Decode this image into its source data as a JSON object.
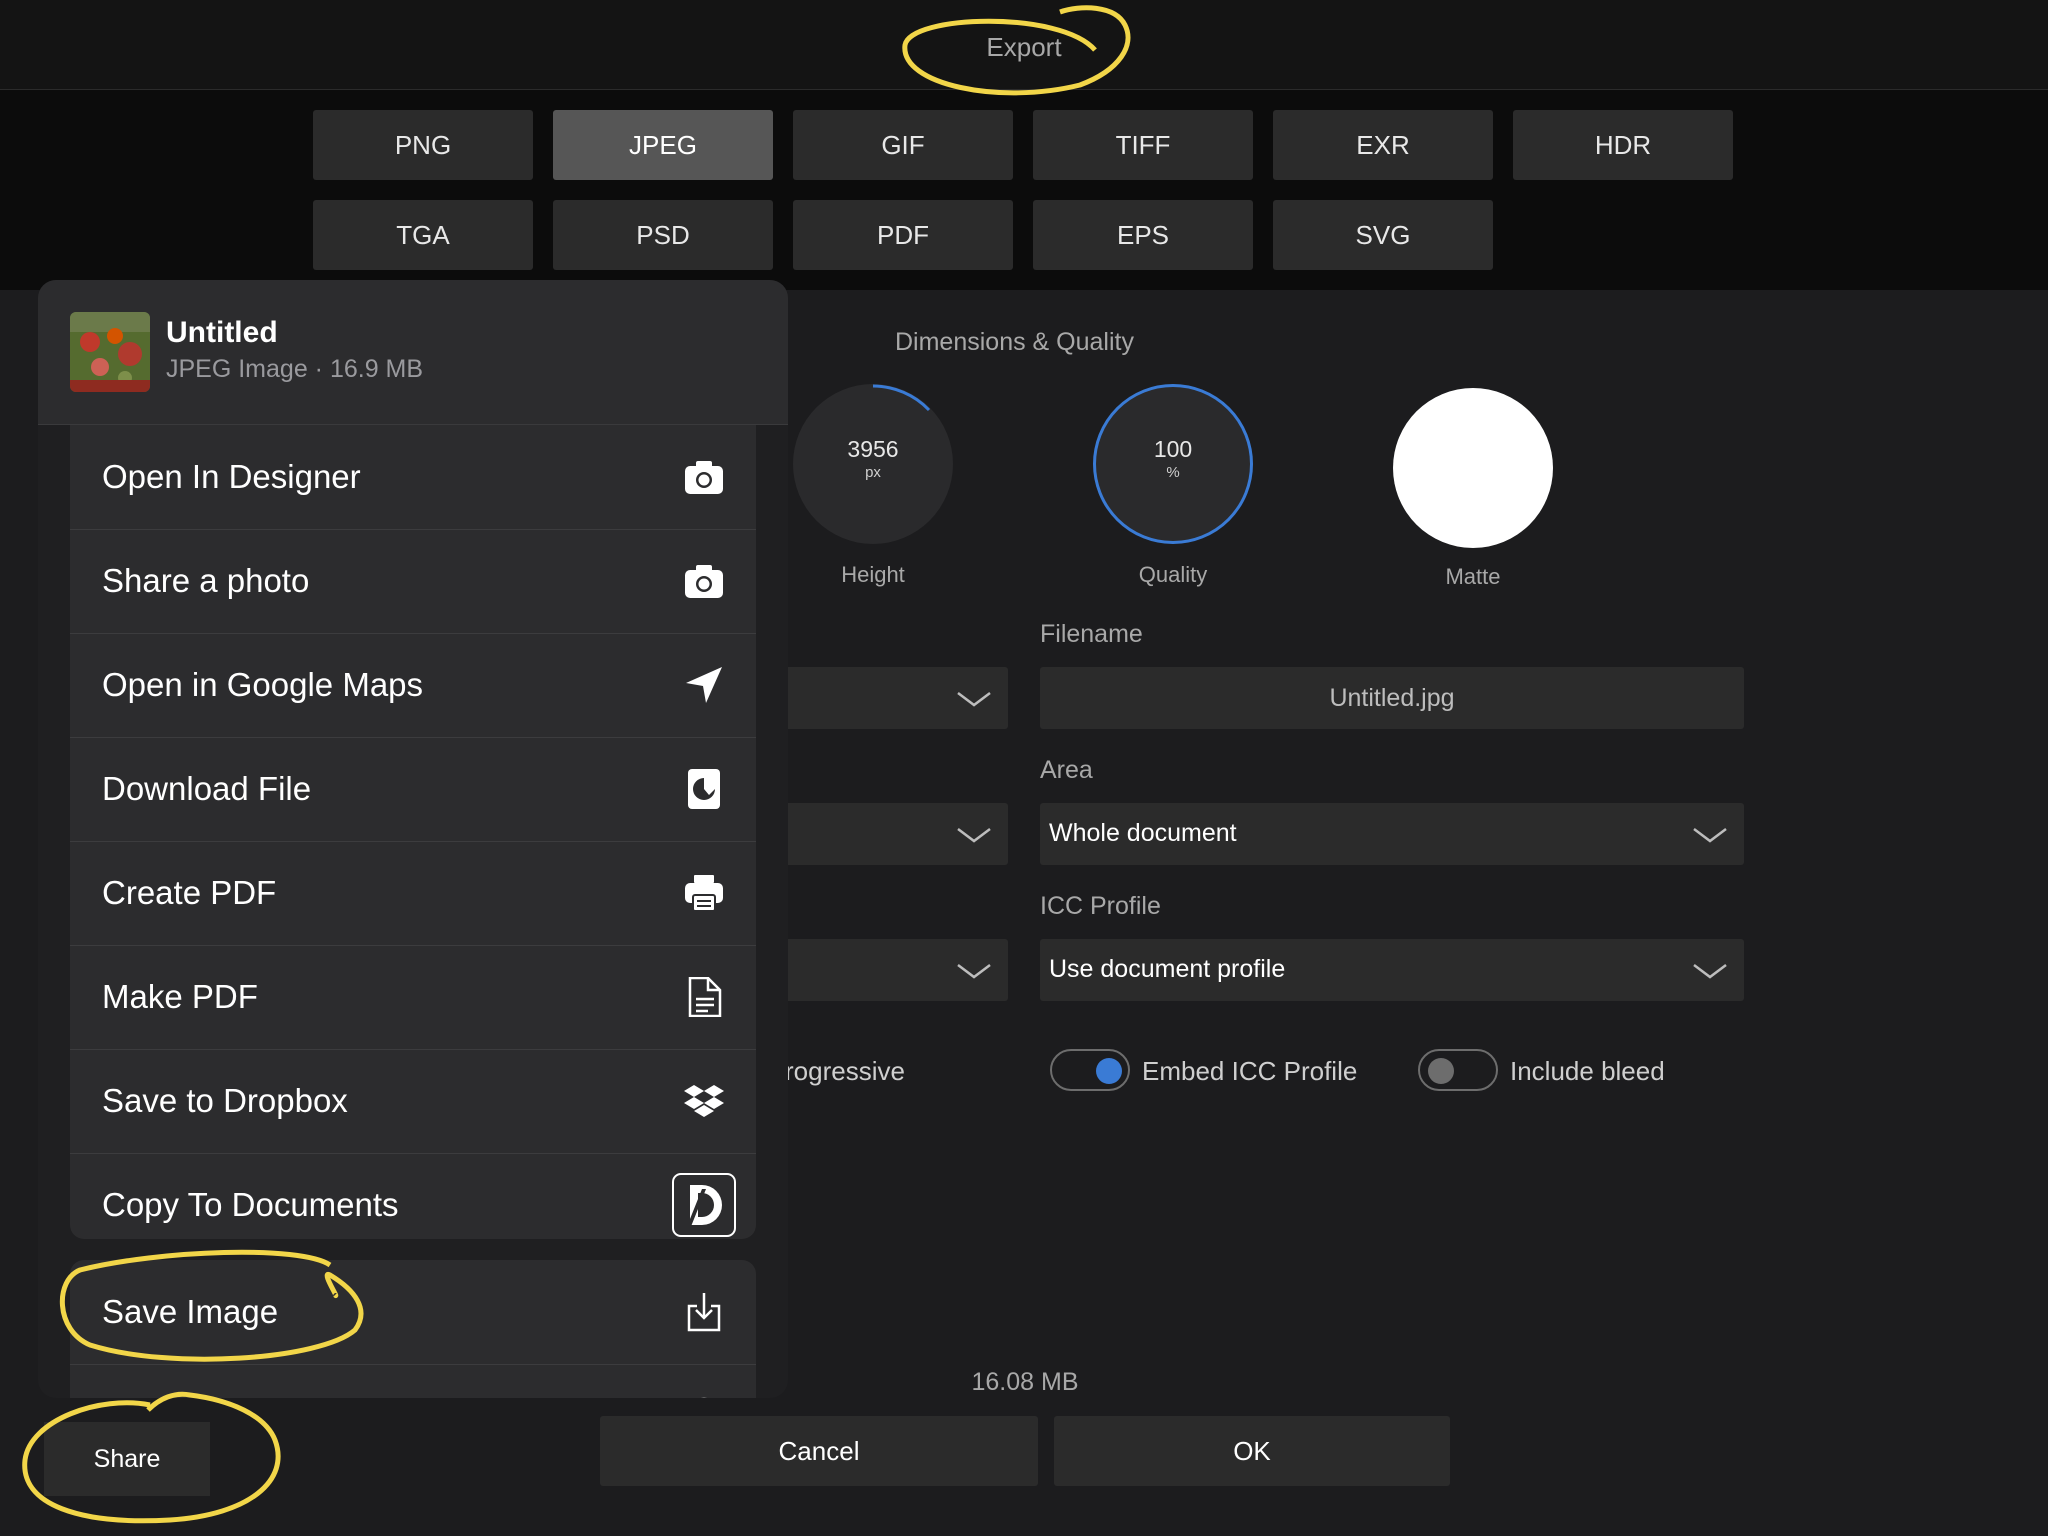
{
  "header": {
    "title": "Export"
  },
  "formats": {
    "row1": [
      "PNG",
      "JPEG",
      "GIF",
      "TIFF",
      "EXR",
      "HDR"
    ],
    "row2": [
      "TGA",
      "PSD",
      "PDF",
      "EPS",
      "SVG"
    ],
    "selected": "JPEG"
  },
  "dimensions": {
    "section_title": "Dimensions & Quality",
    "height": {
      "value": "3956",
      "unit": "px",
      "label": "Height"
    },
    "quality": {
      "value": "100",
      "unit": "%",
      "label": "Quality",
      "level": 1.0
    },
    "matte": {
      "label": "Matte",
      "color": "#ffffff"
    }
  },
  "filename": {
    "label": "Filename",
    "value": "Untitled.jpg"
  },
  "area": {
    "label": "Area",
    "value": "Whole document"
  },
  "icc": {
    "label": "ICC Profile",
    "value": "Use document profile"
  },
  "options": {
    "progressive_label": "rogressive",
    "embed_icc": {
      "label": "Embed ICC Profile",
      "on": true
    },
    "include_bleed": {
      "label": "Include bleed",
      "on": false
    }
  },
  "estimate": "16.08 MB",
  "footer": {
    "cancel": "Cancel",
    "ok": "OK",
    "share": "Share"
  },
  "share_sheet": {
    "doc_name": "Untitled",
    "doc_meta": "JPEG Image · 16.9 MB",
    "actions": [
      {
        "label": "Open In Designer",
        "icon": "camera-icon"
      },
      {
        "label": "Share a photo",
        "icon": "camera-icon"
      },
      {
        "label": "Open in Google Maps",
        "icon": "location-arrow-icon"
      },
      {
        "label": "Download File",
        "icon": "download-file-icon"
      },
      {
        "label": "Create PDF",
        "icon": "printer-icon"
      },
      {
        "label": "Make PDF",
        "icon": "document-icon"
      },
      {
        "label": "Save to Dropbox",
        "icon": "dropbox-icon"
      },
      {
        "label": "Copy To Documents",
        "icon": "documents-app-icon"
      }
    ],
    "save_image": {
      "label": "Save Image",
      "icon": "save-icon"
    }
  },
  "colors": {
    "accent": "#3a7bd5",
    "annotation": "#f2d649",
    "background": "#1c1c1e"
  }
}
